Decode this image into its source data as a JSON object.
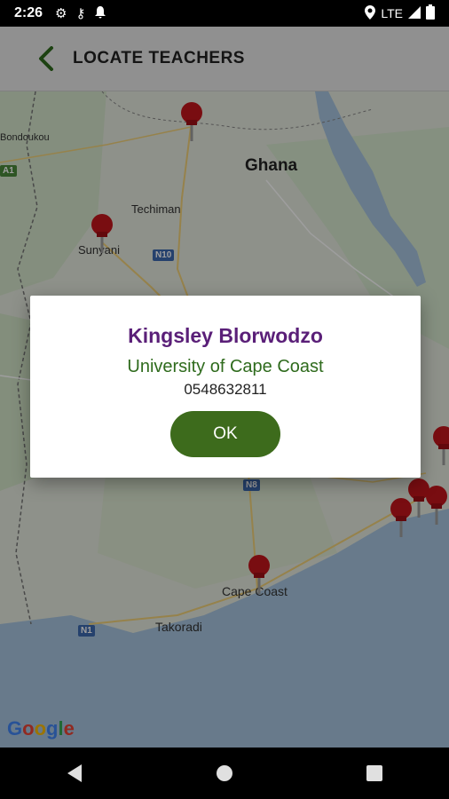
{
  "status_bar": {
    "time": "2:26",
    "network": "LTE",
    "icons": [
      "settings-icon",
      "key-icon",
      "notification-bell-icon",
      "location-icon",
      "signal-icon",
      "battery-icon"
    ]
  },
  "app_bar": {
    "title": "LOCATE TEACHERS",
    "back_icon": "chevron-left-icon",
    "accent_color": "#2f6b1d"
  },
  "map": {
    "labels": {
      "ghana": "Ghana",
      "bondoukou": "Bondoukou",
      "techiman": "Techiman",
      "sunyani": "Sunyani",
      "cape_coast": "Cape Coast",
      "takoradi": "Takoradi"
    },
    "road_shields": {
      "n10": "N10",
      "n8": "N8",
      "n1": "N1",
      "a1": "A1"
    },
    "logo": "Google",
    "pin_color": "#c4161c"
  },
  "dialog": {
    "name": "Kingsley Blorwodzo",
    "school": "University of Cape Coast",
    "phone": "0548632811",
    "ok_label": "OK",
    "name_color": "#5a1f78",
    "school_color": "#2f6b1d",
    "button_color": "#3d6b1c"
  },
  "nav_bar": {
    "icons": [
      "back-triangle-icon",
      "home-circle-icon",
      "recents-square-icon"
    ]
  }
}
